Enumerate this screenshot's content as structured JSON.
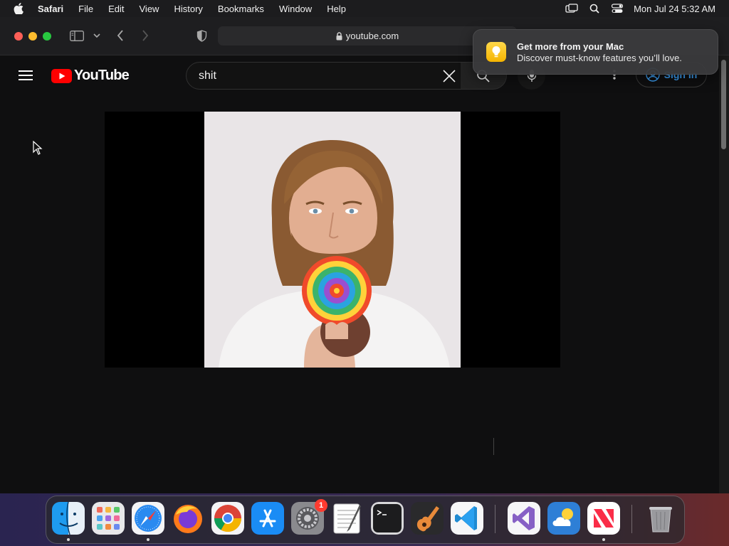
{
  "menubar": {
    "app_name": "Safari",
    "menus": [
      "File",
      "Edit",
      "View",
      "History",
      "Bookmarks",
      "Window",
      "Help"
    ],
    "clock": "Mon Jul 24  5:32 AM"
  },
  "browser": {
    "url": "youtube.com"
  },
  "youtube": {
    "logo_text": "YouTube",
    "search_query": "shit",
    "sign_in_label": "Sign in",
    "colors": {
      "brand_red": "#ff0000",
      "link_blue": "#3ea6ff"
    }
  },
  "notification": {
    "title": "Get more from your Mac",
    "body": "Discover must-know features you’ll love."
  },
  "dock": {
    "items": [
      "Finder",
      "Launchpad",
      "Safari",
      "Firefox",
      "Google Chrome",
      "App Store",
      "System Settings",
      "TextEdit",
      "Terminal",
      "GarageBand",
      "Visual Studio Code",
      "Visual Studio",
      "Weather",
      "News",
      "Trash"
    ],
    "settings_badge": "1"
  }
}
